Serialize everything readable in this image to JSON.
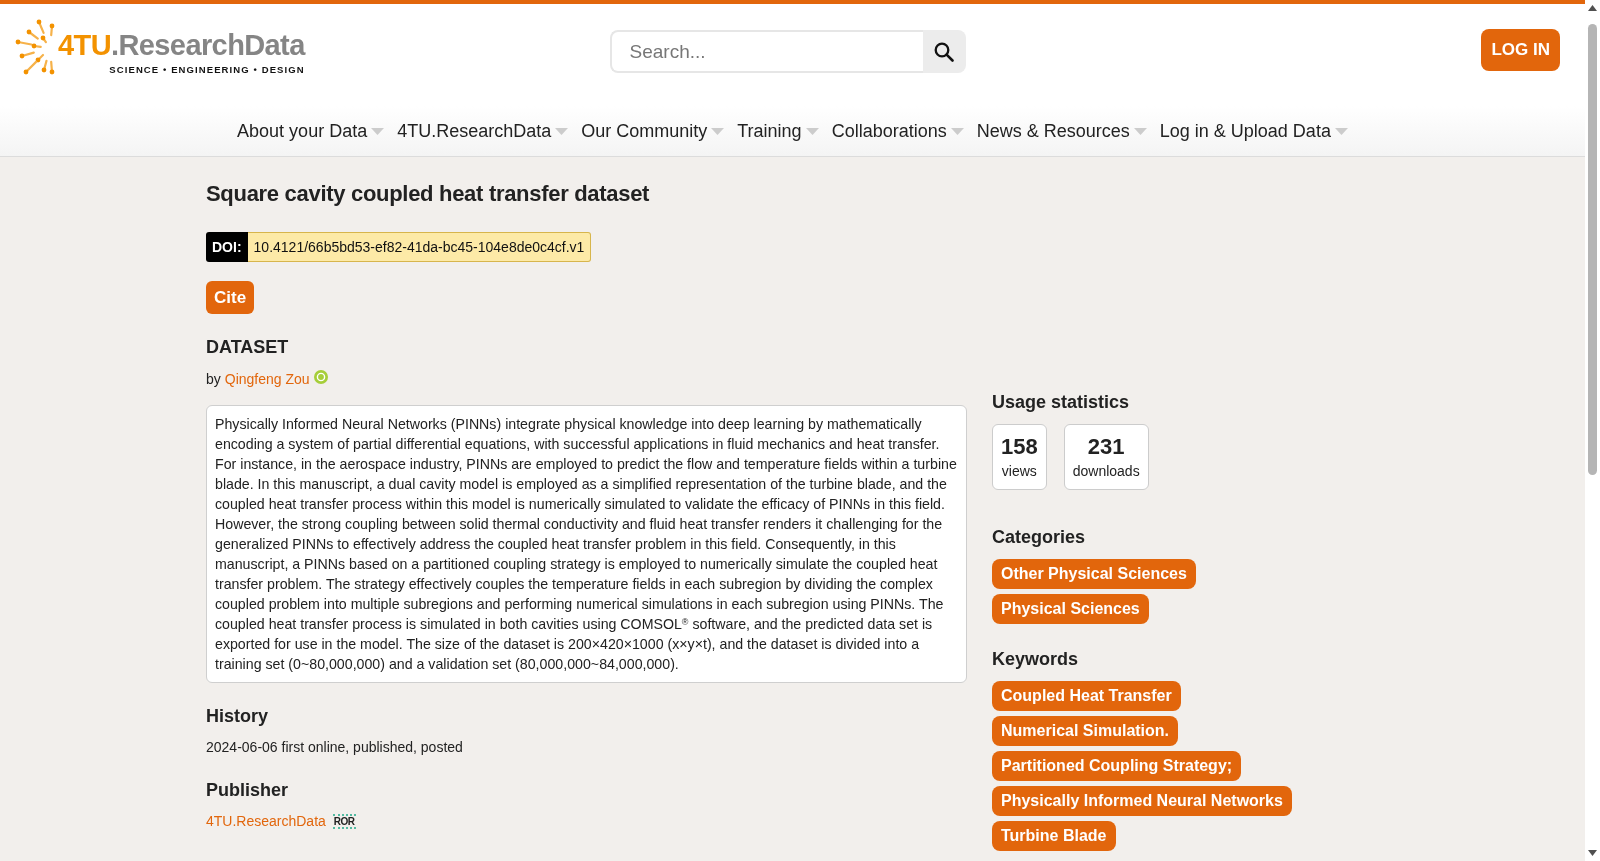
{
  "header": {
    "logo": {
      "prefix": "4TU",
      "name": ".ResearchData",
      "tagline": "SCIENCE • ENGINEERING • DESIGN"
    },
    "search": {
      "placeholder": "Search..."
    },
    "login_button": "LOG IN"
  },
  "nav": [
    "About your Data",
    "4TU.ResearchData",
    "Our Community",
    "Training",
    "Collaborations",
    "News & Resources",
    "Log in & Upload Data"
  ],
  "dataset": {
    "title": "Square cavity coupled heat transfer dataset",
    "doi": {
      "label": "DOI:",
      "value": "10.4121/66b5bd53-ef82-41da-bc45-104e8de0c4cf.v1"
    },
    "cite_button": "Cite",
    "type": "DATASET",
    "byline": {
      "prefix": "by",
      "author": "Qingfeng Zou"
    },
    "description": "Physically Informed Neural Networks (PINNs) integrate physical knowledge into deep learning by mathematically encoding a system of partial differential equations, with successful applications in fluid mechanics and heat transfer. For instance, in the aerospace industry, PINNs are employed to predict the flow and temperature fields within a turbine blade. In this manuscript, a dual cavity model is employed as a simplified representation of the turbine blade, and the coupled heat transfer process within this model is numerically simulated to validate the efficacy of PINNs in this field. However, the strong coupling between solid thermal conductivity and fluid heat transfer renders it challenging for the generalized PINNs to effectively address the coupled heat transfer problem in this field. Consequently, in this manuscript, a PINNs based on a partitioned coupling strategy is employed to numerically simulate the coupled heat transfer problem. The strategy effectively couples the temperature fields in each subregion by dividing the complex coupled problem into multiple subregions and performing numerical simulations in each subregion using PINNs. The coupled heat transfer process is simulated in both cavities using COMSOL$^{®}$ software, and the predicted data set is exported for use in the model. The size of the dataset is 200×420×1000 (x×y×t), and the dataset is divided into a training set (0~80,000,000) and a validation set (80,000,000~84,000,000).",
    "history": {
      "title": "History",
      "text": "2024-06-06 first online, published, posted"
    },
    "publisher": {
      "title": "Publisher",
      "link": "4TU.ResearchData",
      "registry": "ROR"
    }
  },
  "sidebar": {
    "usage_statistics": {
      "title": "Usage statistics",
      "stats": [
        {
          "value": "158",
          "label": "views"
        },
        {
          "value": "231",
          "label": "downloads"
        }
      ]
    },
    "categories": {
      "title": "Categories",
      "items": [
        "Other Physical Sciences",
        "Physical Sciences"
      ]
    },
    "keywords": {
      "title": "Keywords",
      "items": [
        "Coupled Heat Transfer",
        "Numerical Simulation.",
        "Partitioned Coupling Strategy;",
        "Physically Informed Neural Networks",
        "Turbine Blade"
      ]
    }
  }
}
